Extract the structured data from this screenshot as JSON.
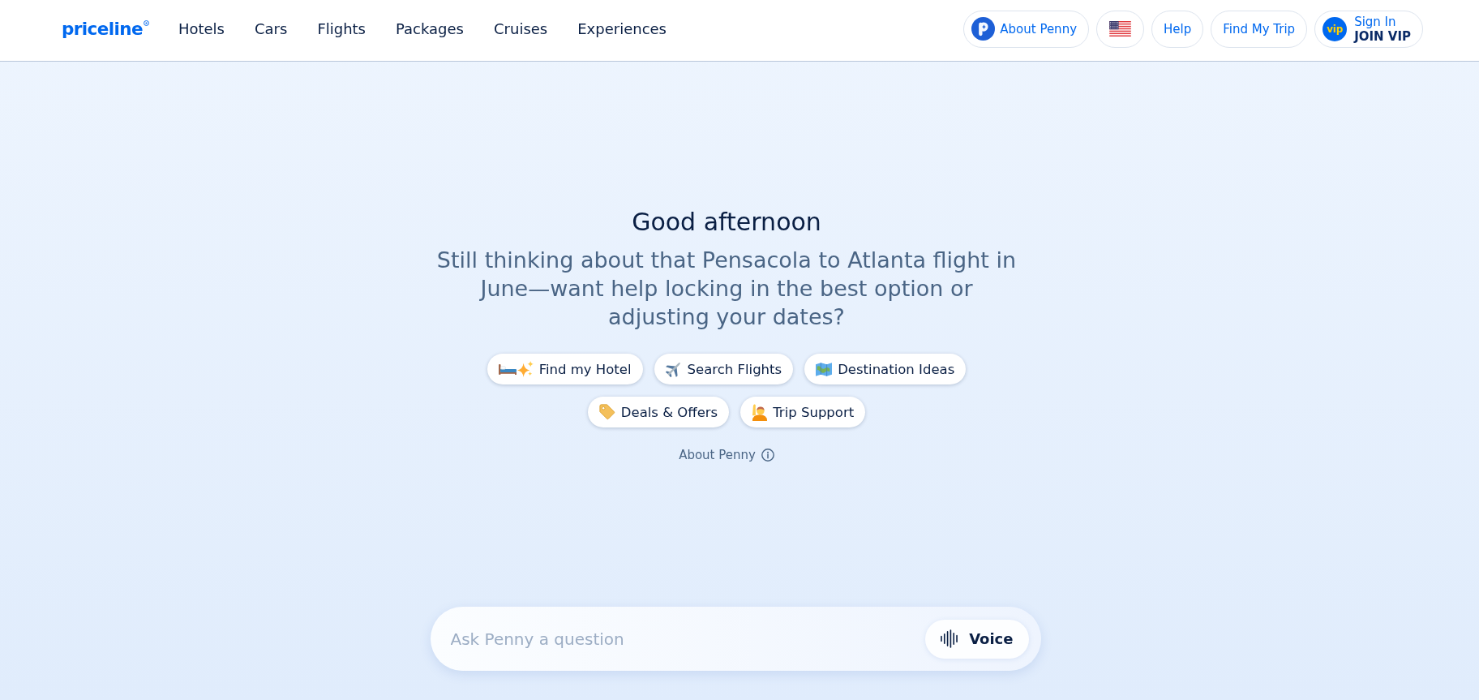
{
  "header": {
    "logo": "priceline",
    "nav": [
      "Hotels",
      "Cars",
      "Flights",
      "Packages",
      "Cruises",
      "Experiences"
    ],
    "actions": [
      {
        "kind": "penny",
        "label": "About Penny"
      },
      {
        "kind": "flag"
      },
      {
        "kind": "link",
        "label": "Help"
      },
      {
        "kind": "link",
        "label": "Find My Trip"
      },
      {
        "kind": "account",
        "badge": "vip",
        "label": "Sign In",
        "sublabel": "JOIN VIP"
      }
    ]
  },
  "hero": {
    "greeting": "Good afternoon",
    "message": "Still thinking about that Pensacola to Atlanta flight in June—want help locking in the best option or adjusting your dates?",
    "chips": [
      {
        "kind": "hotel",
        "label": "Find my Hotel"
      },
      {
        "kind": "flights",
        "label": "Search Flights"
      },
      {
        "kind": "destinations",
        "label": "Destination Ideas"
      },
      {
        "kind": "deals",
        "label": "Deals & Offers"
      },
      {
        "kind": "support",
        "label": "Trip Support"
      }
    ],
    "about_link": "About Penny"
  },
  "ask_bar": {
    "placeholder": "Ask Penny a question",
    "voice_button": "Voice"
  }
}
